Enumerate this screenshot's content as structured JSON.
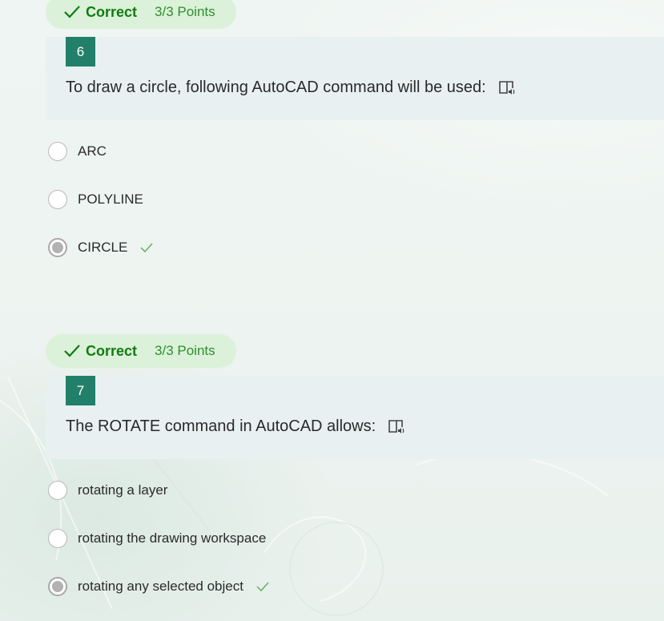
{
  "questions": [
    {
      "status": "Correct",
      "points": "3/3 Points",
      "number": "6",
      "text": "To draw a circle, following AutoCAD command will be used:",
      "options": [
        {
          "label": "ARC",
          "selected": false
        },
        {
          "label": "POLYLINE",
          "selected": false
        },
        {
          "label": "CIRCLE",
          "selected": true,
          "correct": true
        }
      ]
    },
    {
      "status": "Correct",
      "points": "3/3 Points",
      "number": "7",
      "text": "The ROTATE command in AutoCAD allows:",
      "options": [
        {
          "label": "rotating a layer",
          "selected": false
        },
        {
          "label": "rotating the drawing workspace",
          "selected": false
        },
        {
          "label": "rotating any selected object",
          "selected": true,
          "correct": true
        }
      ]
    }
  ],
  "colors": {
    "accent": "#22806a",
    "correct_text": "#107c10",
    "badge_bg": "#dbf1d9",
    "question_bg": "#e8f0f1"
  },
  "icons": {
    "status": "checkmark-icon",
    "reader": "immersive-reader-icon",
    "answer_mark": "checkmark-icon"
  }
}
